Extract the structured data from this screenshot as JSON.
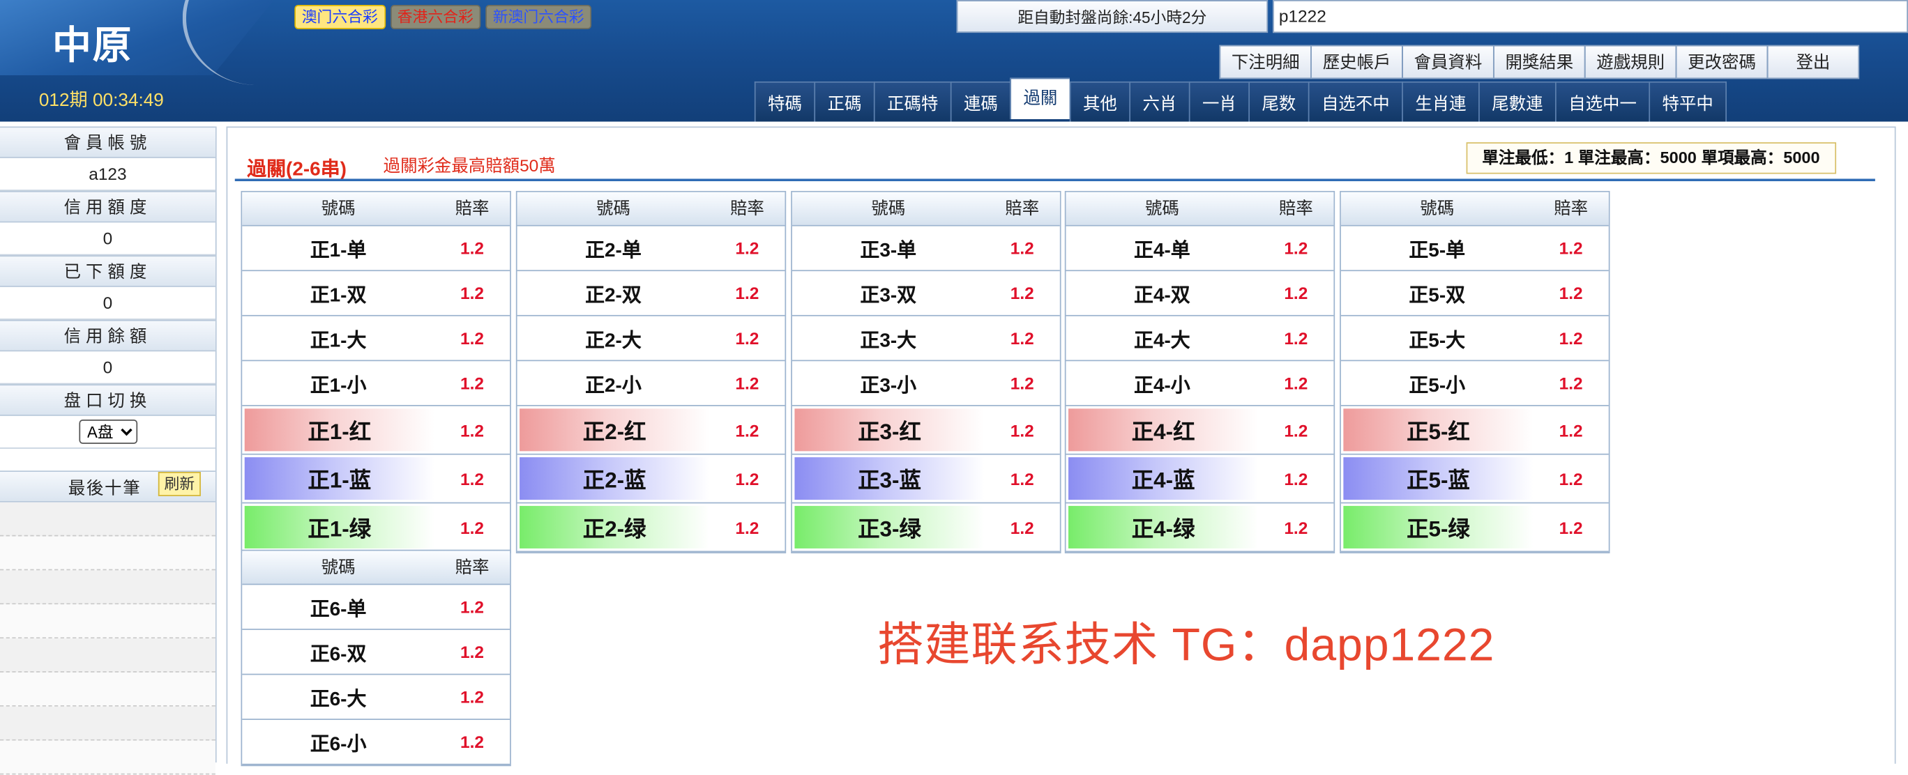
{
  "header": {
    "logo": "中原",
    "period": "012期 00:34:49",
    "lottery_tabs": [
      "澳门六合彩",
      "香港六合彩",
      "新澳门六合彩"
    ],
    "countdown": "距自動封盤尚餘:45小時2分",
    "username": "p1222",
    "top_menu": [
      "下注明細",
      "歷史帳戶",
      "會員資料",
      "開獎結果",
      "遊戲規則",
      "更改密碼",
      "登出"
    ],
    "nav_tabs": [
      "特碼",
      "正碼",
      "正碼特",
      "連碼",
      "過關",
      "其他",
      "六肖",
      "一肖",
      "尾数",
      "自选不中",
      "生肖連",
      "尾數連",
      "自选中一",
      "特平中"
    ],
    "active_tab": "過關"
  },
  "sidebar": {
    "account_label": "會員帳號",
    "account_value": "a123",
    "credit_label": "信用額度",
    "credit_value": "0",
    "used_label": "已下額度",
    "used_value": "0",
    "balance_label": "信用餘額",
    "balance_value": "0",
    "handicap_label": "盘口切换",
    "handicap_value": "A盘",
    "recent_title": "最後十筆",
    "refresh_label": "刷新"
  },
  "main": {
    "title": "過關(2-6串)",
    "subtitle": "過關彩金最高賠額50萬",
    "limits": "單注最低：1  單注最高：5000  單項最高：5000",
    "col_header_number": "號碼",
    "col_header_odds": "賠率",
    "groups": [
      {
        "items": [
          {
            "name": "正1-单",
            "odds": "1.2"
          },
          {
            "name": "正1-双",
            "odds": "1.2"
          },
          {
            "name": "正1-大",
            "odds": "1.2"
          },
          {
            "name": "正1-小",
            "odds": "1.2"
          },
          {
            "name": "正1-红",
            "odds": "1.2"
          },
          {
            "name": "正1-蓝",
            "odds": "1.2"
          },
          {
            "name": "正1-绿",
            "odds": "1.2"
          }
        ]
      },
      {
        "items": [
          {
            "name": "正2-单",
            "odds": "1.2"
          },
          {
            "name": "正2-双",
            "odds": "1.2"
          },
          {
            "name": "正2-大",
            "odds": "1.2"
          },
          {
            "name": "正2-小",
            "odds": "1.2"
          },
          {
            "name": "正2-红",
            "odds": "1.2"
          },
          {
            "name": "正2-蓝",
            "odds": "1.2"
          },
          {
            "name": "正2-绿",
            "odds": "1.2"
          }
        ]
      },
      {
        "items": [
          {
            "name": "正3-单",
            "odds": "1.2"
          },
          {
            "name": "正3-双",
            "odds": "1.2"
          },
          {
            "name": "正3-大",
            "odds": "1.2"
          },
          {
            "name": "正3-小",
            "odds": "1.2"
          },
          {
            "name": "正3-红",
            "odds": "1.2"
          },
          {
            "name": "正3-蓝",
            "odds": "1.2"
          },
          {
            "name": "正3-绿",
            "odds": "1.2"
          }
        ]
      },
      {
        "items": [
          {
            "name": "正4-单",
            "odds": "1.2"
          },
          {
            "name": "正4-双",
            "odds": "1.2"
          },
          {
            "name": "正4-大",
            "odds": "1.2"
          },
          {
            "name": "正4-小",
            "odds": "1.2"
          },
          {
            "name": "正4-红",
            "odds": "1.2"
          },
          {
            "name": "正4-蓝",
            "odds": "1.2"
          },
          {
            "name": "正4-绿",
            "odds": "1.2"
          }
        ]
      },
      {
        "items": [
          {
            "name": "正5-单",
            "odds": "1.2"
          },
          {
            "name": "正5-双",
            "odds": "1.2"
          },
          {
            "name": "正5-大",
            "odds": "1.2"
          },
          {
            "name": "正5-小",
            "odds": "1.2"
          },
          {
            "name": "正5-红",
            "odds": "1.2"
          },
          {
            "name": "正5-蓝",
            "odds": "1.2"
          },
          {
            "name": "正5-绿",
            "odds": "1.2"
          }
        ]
      },
      {
        "items": [
          {
            "name": "正6-单",
            "odds": "1.2"
          },
          {
            "name": "正6-双",
            "odds": "1.2"
          },
          {
            "name": "正6-大",
            "odds": "1.2"
          },
          {
            "name": "正6-小",
            "odds": "1.2"
          }
        ]
      }
    ],
    "watermark": "搭建联系技术 TG：dapp1222"
  }
}
